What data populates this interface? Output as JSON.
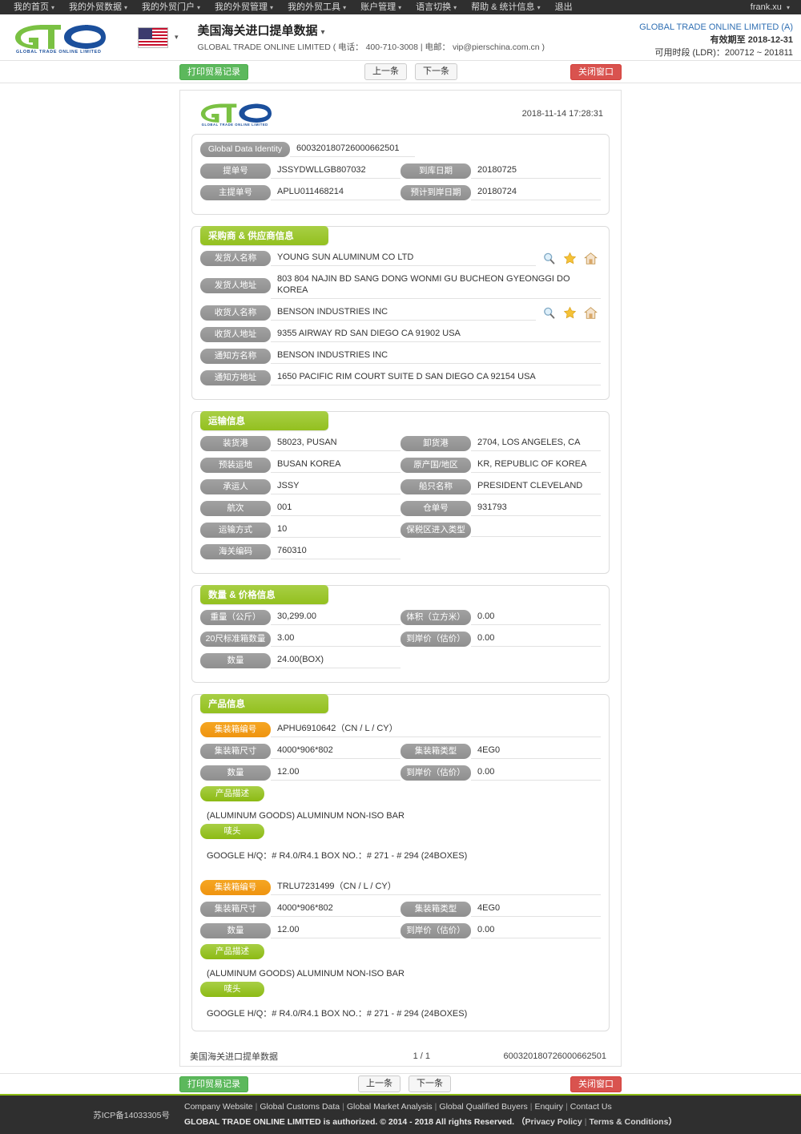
{
  "topnav": {
    "items": [
      {
        "label": "我的首页",
        "caret": "▾"
      },
      {
        "label": "我的外贸数据",
        "caret": "▾"
      },
      {
        "label": "我的外贸门户",
        "caret": "▾"
      },
      {
        "label": "我的外贸管理",
        "caret": "▾"
      },
      {
        "label": "我的外贸工具",
        "caret": "▾"
      },
      {
        "label": "账户管理",
        "caret": "▾"
      },
      {
        "label": "语言切换",
        "caret": "▾"
      },
      {
        "label": "帮助 & 统计信息",
        "caret": "▾"
      },
      {
        "label": "退出",
        "caret": ""
      }
    ],
    "user": "frank.xu",
    "user_caret": "▾"
  },
  "header": {
    "logo_text": "GLOBAL TRADE ONLINE LIMITED",
    "flag_name": "us-flag",
    "flag_caret": "▾",
    "title": "美国海关进口提单数据",
    "title_caret": "▾",
    "subtitle": "GLOBAL TRADE ONLINE LIMITED ( 电话： 400-710-3008 | 电邮： vip@pierschina.com.cn )",
    "account_name": "GLOBAL TRADE ONLINE LIMITED (A)",
    "valid_until": "有效期至 2018-12-31",
    "ldr": "可用时段 (LDR)：200712 ~ 201811"
  },
  "actions": {
    "print": "打印贸易记录",
    "prev": "上一条",
    "next": "下一条",
    "close": "关闭窗口"
  },
  "doc": {
    "timestamp": "2018-11-14 17:28:31",
    "identity": {
      "label": "Global Data Identity",
      "value": "600320180726000662501"
    },
    "bill": {
      "bl_label": "提单号",
      "bl_value": "JSSYDWLLGB807032",
      "arrival_label": "到库日期",
      "arrival_value": "20180725",
      "master_label": "主提单号",
      "master_value": "APLU011468214",
      "eta_label": "预计到岸日期",
      "eta_value": "20180724"
    },
    "parties": {
      "title": "采购商 & 供应商信息",
      "rows": [
        {
          "label": "发货人名称",
          "value": "YOUNG SUN ALUMINUM CO LTD",
          "icons": true
        },
        {
          "label": "发货人地址",
          "value": "803 804 NAJIN BD SANG DONG WONMI GU BUCHEON GYEONGGI DO KOREA",
          "icons": false
        },
        {
          "label": "收货人名称",
          "value": "BENSON INDUSTRIES INC",
          "icons": true
        },
        {
          "label": "收货人地址",
          "value": "9355 AIRWAY RD SAN DIEGO CA 91902 USA",
          "icons": false
        },
        {
          "label": "通知方名称",
          "value": "BENSON INDUSTRIES INC",
          "icons": false
        },
        {
          "label": "通知方地址",
          "value": "1650 PACIFIC RIM COURT SUITE D SAN DIEGO CA 92154 USA",
          "icons": false
        }
      ]
    },
    "transport": {
      "title": "运输信息",
      "rows": [
        {
          "l1": "装货港",
          "v1": "58023, PUSAN",
          "l2": "卸货港",
          "v2": "2704, LOS ANGELES, CA"
        },
        {
          "l1": "预装运地",
          "v1": "BUSAN KOREA",
          "l2": "原产国/地区",
          "v2": "KR, REPUBLIC OF KOREA"
        },
        {
          "l1": "承运人",
          "v1": "JSSY",
          "l2": "船只名称",
          "v2": "PRESIDENT CLEVELAND"
        },
        {
          "l1": "航次",
          "v1": "001",
          "l2": "仓单号",
          "v2": "931793"
        },
        {
          "l1": "运输方式",
          "v1": "10",
          "l2": "保税区进入类型",
          "v2": ""
        },
        {
          "l1": "海关编码",
          "v1": "760310",
          "l2": "",
          "v2": ""
        }
      ]
    },
    "quantity": {
      "title": "数量 & 价格信息",
      "rows": [
        {
          "l1": "重量（公斤）",
          "v1": "30,299.00",
          "l2": "体积（立方米）",
          "v2": "0.00"
        },
        {
          "l1": "20尺标准箱数量",
          "v1": "3.00",
          "l2": "到岸价（估价）",
          "v2": "0.00"
        },
        {
          "l1": "数量",
          "v1": "24.00(BOX)",
          "l2": "",
          "v2": ""
        }
      ]
    },
    "products": {
      "title": "产品信息",
      "labels": {
        "container_no": "集装箱编号",
        "container_size": "集装箱尺寸",
        "container_type": "集装箱类型",
        "quantity": "数量",
        "cif": "到岸价（估价）",
        "description": "产品描述",
        "marks": "唛头"
      },
      "items": [
        {
          "container_no": "APHU6910642（CN / L / CY）",
          "container_size": "4000*906*802",
          "container_type": "4EG0",
          "quantity": "12.00",
          "cif": "0.00",
          "description": "(ALUMINUM GOODS) ALUMINUM NON-ISO BAR",
          "marks": "GOOGLE H/Q：# R4.0/R4.1 BOX NO.：# 271 - # 294 (24BOXES)"
        },
        {
          "container_no": "TRLU7231499（CN / L / CY）",
          "container_size": "4000*906*802",
          "container_type": "4EG0",
          "quantity": "12.00",
          "cif": "0.00",
          "description": "(ALUMINUM GOODS) ALUMINUM NON-ISO BAR",
          "marks": "GOOGLE H/Q：# R4.0/R4.1 BOX NO.：# 271 - # 294 (24BOXES)"
        }
      ]
    },
    "footer": {
      "name": "美国海关进口提单数据",
      "page": "1 / 1",
      "identity": "600320180726000662501"
    }
  },
  "footer": {
    "icp": "苏ICP备14033305号",
    "links": [
      "Company Website",
      "Global Customs Data",
      "Global Market Analysis",
      "Global Qualified Buyers",
      "Enquiry",
      "Contact Us"
    ],
    "copyright": "GLOBAL TRADE ONLINE LIMITED is authorized. © 2014 - 2018 All rights Reserved.",
    "legal_open": "（",
    "legal": [
      "Privacy Policy",
      "Terms & Conditions"
    ],
    "legal_close": "）"
  },
  "colors": {
    "green": "#8cba14",
    "orange": "#ef9410",
    "red": "#d9534f",
    "grey_pill": "#8f8f8f",
    "link_blue": "#2f6fb3"
  }
}
